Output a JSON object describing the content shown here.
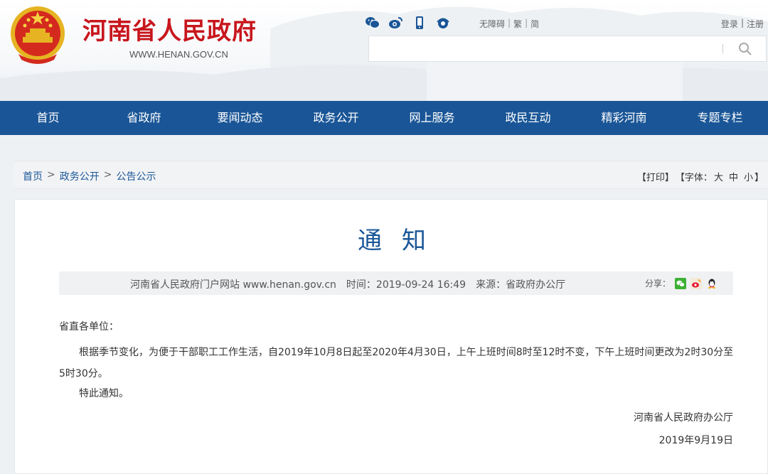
{
  "header": {
    "site_title": "河南省人民政府",
    "site_url": "WWW.HENAN.GOV.CN",
    "social_icons": [
      "wechat-icon",
      "weibo-icon",
      "mobile-icon",
      "app-icon"
    ],
    "accessibility": "无障碍",
    "traditional": "繁",
    "simplified": "简",
    "login": "登录",
    "register": "注册",
    "separator": "|",
    "search": {
      "placeholder": "",
      "value": ""
    }
  },
  "nav": {
    "items": [
      {
        "label": "首页"
      },
      {
        "label": "省政府"
      },
      {
        "label": "要闻动态"
      },
      {
        "label": "政务公开"
      },
      {
        "label": "网上服务"
      },
      {
        "label": "政民互动"
      },
      {
        "label": "精彩河南"
      },
      {
        "label": "专题专栏"
      }
    ]
  },
  "breadcrumb": {
    "items": [
      "首页",
      "政务公开",
      "公告公示"
    ],
    "arrow": ">"
  },
  "tools": {
    "print": "【打印】",
    "font_label": "【字体：",
    "font_large": "大",
    "font_medium": "中",
    "font_small": "小",
    "font_close": "】"
  },
  "article": {
    "title": "通知",
    "meta": {
      "source_site": "河南省人民政府门户网站 www.henan.gov.cn",
      "time": "时间：2019-09-24 16:49",
      "origin": "来源：省政府办公厅"
    },
    "share_label": "分享：",
    "share_icons": [
      "wechat-share-icon",
      "weibo-share-icon",
      "qq-share-icon"
    ],
    "salutation": "省直各单位：",
    "paragraph": "根据季节变化，为便于干部职工工作生活，自2019年10月8日起至2020年4月30日，上午上班时间8时至12时不变，下午上班时间更改为2时30分至5时30分。",
    "closing": "特此通知。",
    "signature_org": "河南省人民政府办公厅",
    "signature_date": "2019年9月19日"
  },
  "colors": {
    "brand_red": "#c8161d",
    "nav_blue": "#1a5697",
    "link_blue": "#1a5697"
  }
}
